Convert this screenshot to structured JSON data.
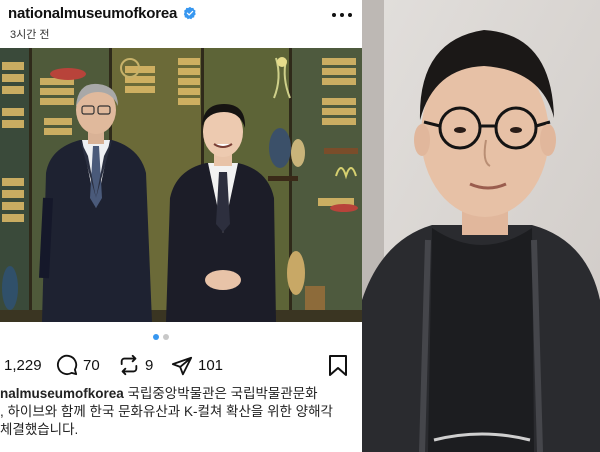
{
  "post": {
    "username": "nationalmuseumofkorea",
    "time": "3시간 전",
    "likes": "1,229",
    "comments": "70",
    "reposts": "9",
    "shares": "101",
    "caption_user": "nalmuseumofkorea",
    "caption_line1_text": " 국립중앙박물관은 국립박물관문화",
    "caption_line2": ", 하이브와 함께 한국 문화유산과 K-컬쳐 확산을 위한 양해각",
    "caption_line3": " 체결했습니다."
  },
  "colors": {
    "verified": "#3797f0",
    "text": "#111111",
    "dot_active": "#3797f0",
    "dot_inactive": "#c8c8c8"
  },
  "icons": {
    "verified": "verified-badge-icon",
    "more": "more-options-icon",
    "comment": "comment-icon",
    "repost": "repost-icon",
    "share": "send-icon",
    "save": "bookmark-icon"
  }
}
